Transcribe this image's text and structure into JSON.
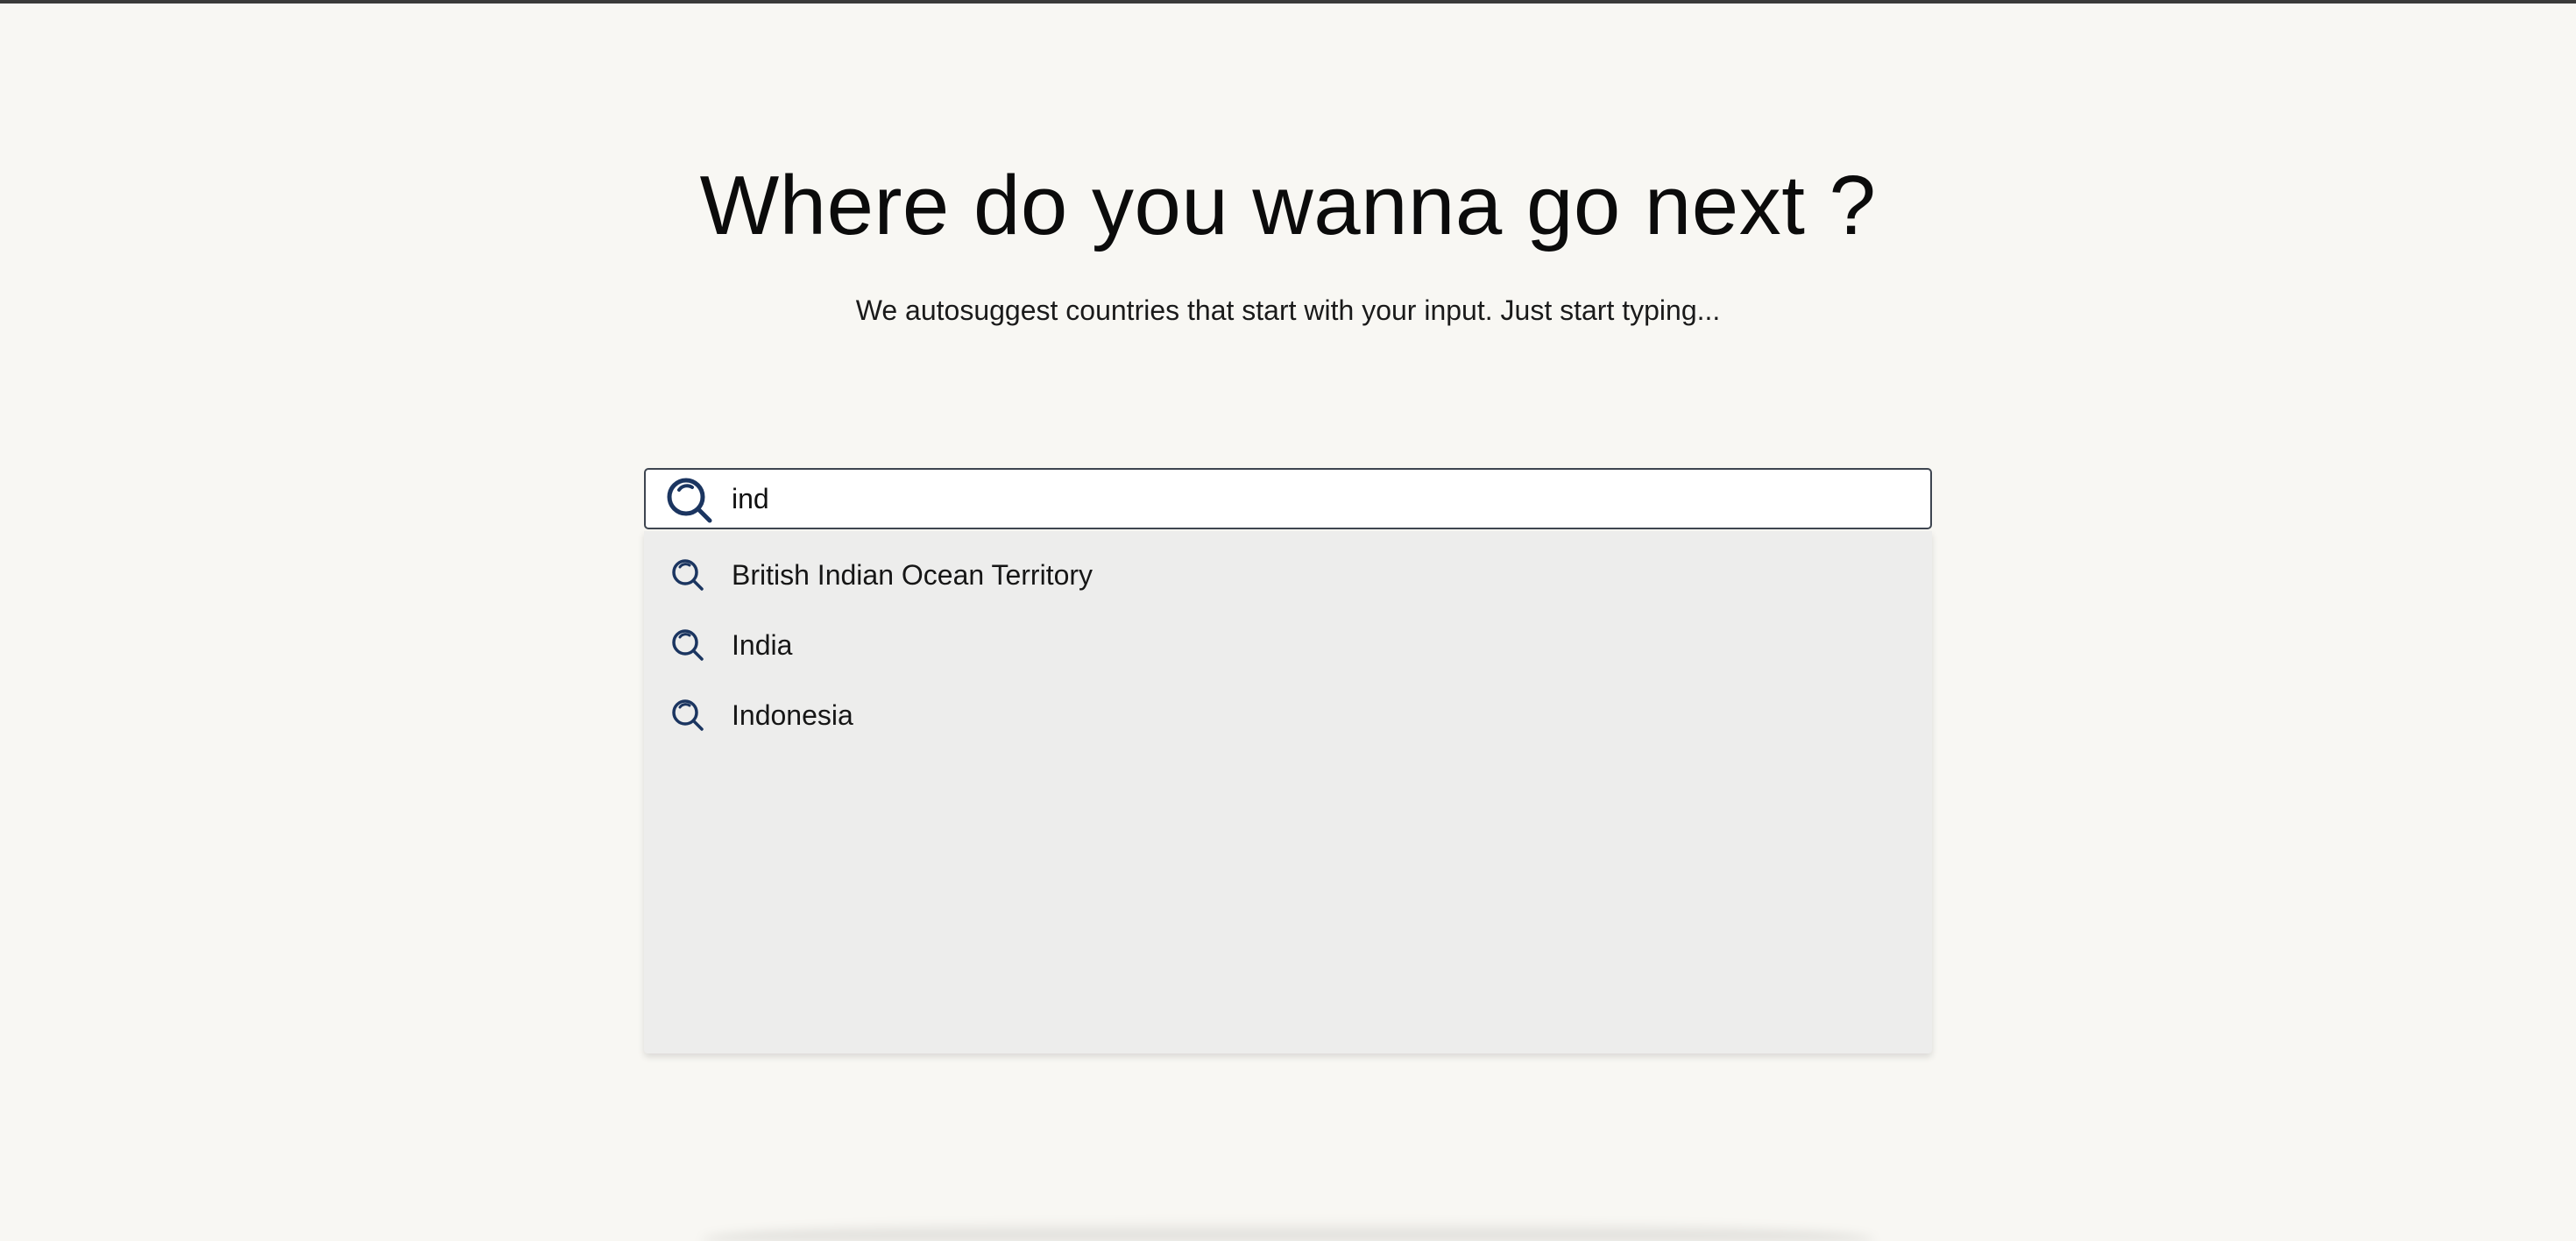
{
  "hero": {
    "title": "Where do you wanna go next ?",
    "subtitle": "We autosuggest countries that start with your input. Just start typing..."
  },
  "search": {
    "value": "ind",
    "icon": "search-icon"
  },
  "suggestions": [
    {
      "label": "British Indian Ocean Territory",
      "icon": "search-icon"
    },
    {
      "label": "India",
      "icon": "search-icon"
    },
    {
      "label": "Indonesia",
      "icon": "search-icon"
    }
  ],
  "colors": {
    "background": "#f8f7f3",
    "icon": "#1b3560",
    "dropdown": "#ededec"
  }
}
